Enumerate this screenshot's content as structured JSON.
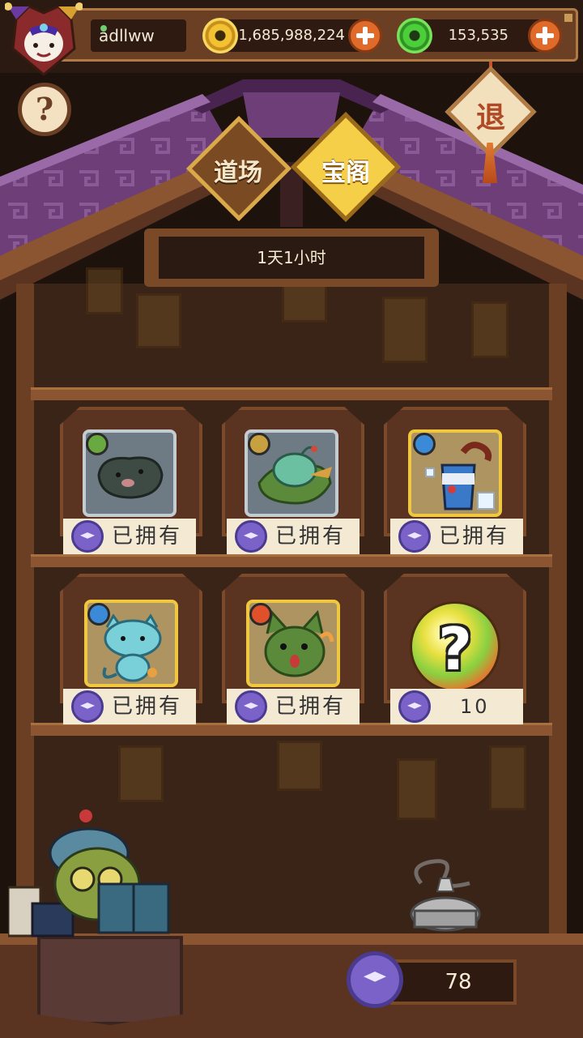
{
  "header": {
    "username": "adllww",
    "gold_amount": "1,685,988,224",
    "jade_amount": "153,535"
  },
  "tabs": [
    {
      "label": "道场",
      "active": false
    },
    {
      "label": "宝阁",
      "active": true
    }
  ],
  "exit_label": "退",
  "help_label": "?",
  "timer": "1天1小时",
  "items": [
    {
      "status": "已拥有",
      "element": "leaf",
      "rarity": "grey"
    },
    {
      "status": "已拥有",
      "element": "earth",
      "rarity": "grey"
    },
    {
      "status": "已拥有",
      "element": "water",
      "rarity": "gold"
    },
    {
      "status": "已拥有",
      "element": "water",
      "rarity": "gold"
    },
    {
      "status": "已拥有",
      "element": "fire",
      "rarity": "gold"
    },
    {
      "price": "10",
      "mystery": true
    }
  ],
  "points": "78",
  "colors": {
    "gold": "#f2c232",
    "jade": "#4ccf3b",
    "accent": "#e06a2a",
    "token": "#7a62c8"
  }
}
